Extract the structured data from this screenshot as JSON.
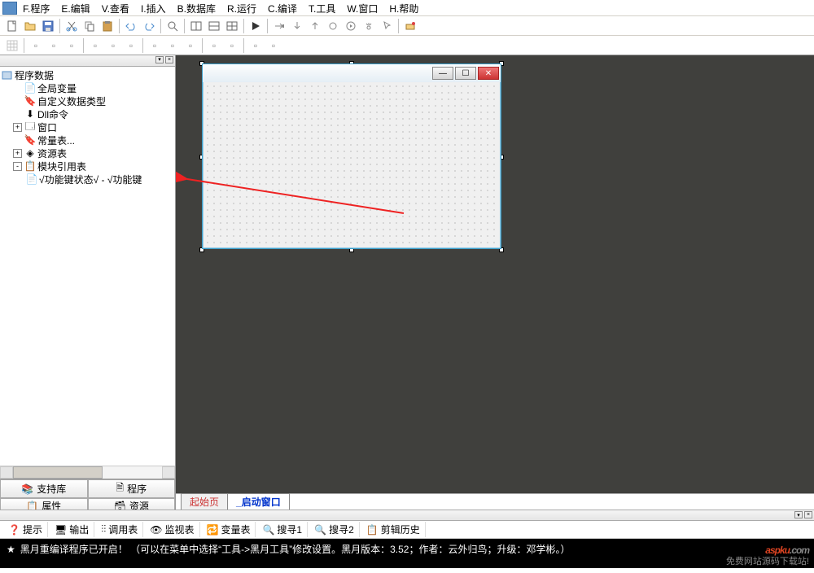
{
  "menu": {
    "file": "F.程序",
    "edit": "E.编辑",
    "view": "V.查看",
    "insert": "I.插入",
    "database": "B.数据库",
    "run": "R.运行",
    "compile": "C.编译",
    "tools": "T.工具",
    "window": "W.窗口",
    "help": "H.帮助"
  },
  "tree": {
    "root": "程序数据",
    "n1": "全局变量",
    "n2": "自定义数据类型",
    "n3": "Dll命令",
    "n4": "窗口",
    "n5": "常量表...",
    "n6": "资源表",
    "n7": "模块引用表",
    "n8": "√功能键状态√ - √功能键"
  },
  "sideTabs": {
    "t1": "支持库",
    "t2": "程序",
    "t3": "属性",
    "t4": "资源"
  },
  "bottomTabs": {
    "start": "起始页",
    "form": "_启动窗口"
  },
  "outputTabs": {
    "hint": "提示",
    "out": "输出",
    "calls": "调用表",
    "watch": "监视表",
    "vars": "变量表",
    "s1": "搜寻1",
    "s2": "搜寻2",
    "clip": "剪辑历史"
  },
  "outputText": "黑月重编译程序已开启！ （可以在菜单中选择“工具->黑月工具”修改设置。黑月版本：3.52；作者：云外归鸟；升级：邓学彬。）",
  "watermark": {
    "logo1": "asp",
    "logo2": "ku",
    "logo3": ".com",
    "sub": "免费网站源码下载站!"
  }
}
